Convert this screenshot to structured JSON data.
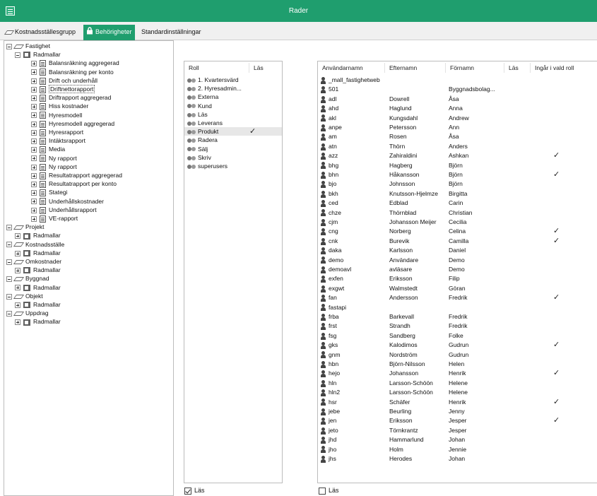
{
  "window": {
    "title": "Rader"
  },
  "tabs": [
    {
      "label": "Kostnadsställesgrupp",
      "icon": "eraser-icon"
    },
    {
      "label": "Behörigheter",
      "icon": "lock-icon",
      "active": true
    },
    {
      "label": "Standardinställningar"
    }
  ],
  "tree": {
    "groups": [
      {
        "label": "Fastighet",
        "child": "Radmallar",
        "items": [
          "Balansräkning aggregerad",
          "Balansräkning per konto",
          "Drift och underhåll",
          "Driftnettorapport",
          "Driftrapport aggregerad",
          "Hiss kostnader",
          "Hyresmodell",
          "Hyresmodell aggregerad",
          "Hyresrapport",
          "Intäktsrapport",
          "Media",
          "Ny rapport",
          "Ny rapport",
          "Resultatrapport aggregerad",
          "Resultatrapport per konto",
          "Stategi",
          "Underhållskostnader",
          "Underhållsrapport",
          "VE-rapport"
        ],
        "selected_item": "Driftnettorapport"
      },
      {
        "label": "Projekt",
        "child": "Radmallar"
      },
      {
        "label": "Kostnadsställe",
        "child": "Radmallar"
      },
      {
        "label": "Omkostnader",
        "child": "Radmallar"
      },
      {
        "label": "Byggnad",
        "child": "Radmallar"
      },
      {
        "label": "Objekt",
        "child": "Radmallar"
      },
      {
        "label": "Uppdrag",
        "child": "Radmallar"
      }
    ]
  },
  "roles": {
    "columns": [
      "Roll",
      "Läs"
    ],
    "rows": [
      {
        "name": "1. Kvartersvärd",
        "las": ""
      },
      {
        "name": "2. Hyresadmin...",
        "las": ""
      },
      {
        "name": "Externa",
        "las": ""
      },
      {
        "name": "Kund",
        "las": ""
      },
      {
        "name": "Läs",
        "las": ""
      },
      {
        "name": "Leverans",
        "las": ""
      },
      {
        "name": "Produkt",
        "las": "✓",
        "selected": true
      },
      {
        "name": "Radera",
        "las": ""
      },
      {
        "name": "Sälj",
        "las": ""
      },
      {
        "name": "Skriv",
        "las": ""
      },
      {
        "name": "superusers",
        "las": ""
      }
    ],
    "las_checkbox_label": "Läs"
  },
  "users": {
    "columns": [
      "Användarnamn",
      "Efternamn",
      "Förnamn",
      "Läs",
      "Ingår i vald roll"
    ],
    "rows": [
      [
        "_mall_fastighetweb",
        "",
        "",
        "",
        ""
      ],
      [
        "501",
        "",
        "Byggnadsbolag...",
        "",
        ""
      ],
      [
        "adl",
        "Dowrell",
        "Åsa",
        "",
        ""
      ],
      [
        "ahd",
        "Haglund",
        "Anna",
        "",
        ""
      ],
      [
        "akl",
        "Kungsdahl",
        "Andrew",
        "",
        ""
      ],
      [
        "anpe",
        "Petersson",
        "Ann",
        "",
        ""
      ],
      [
        "am",
        "Rosen",
        "Åsa",
        "",
        ""
      ],
      [
        "atn",
        "Thörn",
        "Anders",
        "",
        ""
      ],
      [
        "azz",
        "Zahiraldini",
        "Ashkan",
        "",
        "✓"
      ],
      [
        "bhg",
        "Hagberg",
        "Björn",
        "",
        ""
      ],
      [
        "bhn",
        "Håkansson",
        "Björn",
        "",
        "✓"
      ],
      [
        "bjo",
        "Johnsson",
        "Björn",
        "",
        ""
      ],
      [
        "bkh",
        "Knutsson-Hjelmze",
        "Birgitta",
        "",
        ""
      ],
      [
        "ced",
        "Edblad",
        "Carin",
        "",
        ""
      ],
      [
        "chze",
        "Thörnblad",
        "Christian",
        "",
        ""
      ],
      [
        "cjm",
        "Johansson Meijer",
        "Cecilia",
        "",
        ""
      ],
      [
        "cng",
        "Norberg",
        "Celina",
        "",
        "✓"
      ],
      [
        "cnk",
        "Burevik",
        "Camilla",
        "",
        "✓"
      ],
      [
        "daka",
        "Karlsson",
        "Daniel",
        "",
        ""
      ],
      [
        "demo",
        "Användare",
        "Demo",
        "",
        ""
      ],
      [
        "demoavl",
        "avläsare",
        "Demo",
        "",
        ""
      ],
      [
        "exfen",
        "Eriksson",
        "Filip",
        "",
        ""
      ],
      [
        "exgwt",
        "Walmstedt",
        "Göran",
        "",
        ""
      ],
      [
        "fan",
        "Andersson",
        "Fredrik",
        "",
        "✓"
      ],
      [
        "fastapi",
        "",
        "",
        "",
        ""
      ],
      [
        "frba",
        "Barkevall",
        "Fredrik",
        "",
        ""
      ],
      [
        "frst",
        "Strandh",
        "Fredrik",
        "",
        ""
      ],
      [
        "fsg",
        "Sandberg",
        "Folke",
        "",
        ""
      ],
      [
        "gks",
        "Kalodimos",
        "Gudrun",
        "",
        "✓"
      ],
      [
        "gnm",
        "Nordström",
        "Gudrun",
        "",
        ""
      ],
      [
        "hbn",
        "Björn-Nilsson",
        "Helen",
        "",
        ""
      ],
      [
        "hejo",
        "Johansson",
        "Henrik",
        "",
        "✓"
      ],
      [
        "hln",
        "Larsson-Schöön",
        "Helene",
        "",
        ""
      ],
      [
        "hln2",
        "Larsson-Schöön",
        "Helene",
        "",
        ""
      ],
      [
        "hsr",
        "Schäfer",
        "Henrik",
        "",
        "✓"
      ],
      [
        "jebe",
        "Beurling",
        "Jenny",
        "",
        ""
      ],
      [
        "jen",
        "Eriksson",
        "Jesper",
        "",
        "✓"
      ],
      [
        "jeto",
        "Törnkrantz",
        "Jesper",
        "",
        ""
      ],
      [
        "jhd",
        "Hammarlund",
        "Johan",
        "",
        ""
      ],
      [
        "jho",
        "Holm",
        "Jennie",
        "",
        ""
      ],
      [
        "jhs",
        "Herodes",
        "Johan",
        "",
        ""
      ]
    ],
    "las_checkbox_label": "Läs"
  },
  "colors": {
    "titlebar": "#1f9e6e",
    "selected_row": "#e7e7e7"
  }
}
